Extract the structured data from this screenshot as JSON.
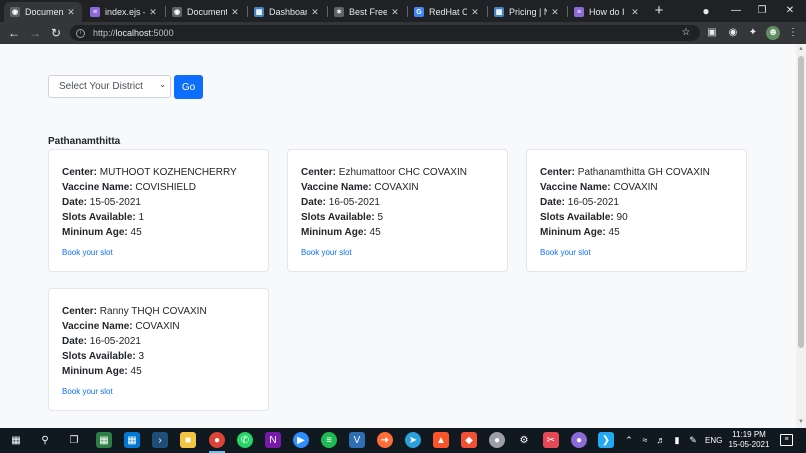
{
  "browser": {
    "tabs": [
      {
        "title": "Document",
        "favicon": "globe-icon",
        "color": "#35363a",
        "active": true
      },
      {
        "title": "index.ejs – ",
        "favicon": "vscode-icon",
        "color": "#8c6ad8"
      },
      {
        "title": "Document",
        "favicon": "globe-icon",
        "color": "#5f6368"
      },
      {
        "title": "Dashboard",
        "favicon": "dashboard-icon",
        "color": "#3d85c6"
      },
      {
        "title": "Best Free N",
        "favicon": "paw-icon",
        "color": "#5f6368"
      },
      {
        "title": "RedHat Op",
        "favicon": "google-icon",
        "color": "#4285f4"
      },
      {
        "title": "Pricing | Nc",
        "favicon": "dashboard-icon",
        "color": "#3d85c6"
      },
      {
        "title": "How do I s",
        "favicon": "chat-icon",
        "color": "#8c6ad8"
      }
    ],
    "url_scheme": "http://",
    "url_host": "localhost",
    "url_port": ":5000"
  },
  "page": {
    "select_placeholder": "Select Your District",
    "go_label": "Go",
    "district": "Pathanamthitta",
    "labels": {
      "center": "Center:",
      "vaccine": "Vaccine Name:",
      "date": "Date:",
      "slots": "Slots Available:",
      "age": "Mininum Age:"
    },
    "book_label": "Book your slot",
    "centers": [
      {
        "center": "MUTHOOT KOZHENCHERRY",
        "vaccine": "COVISHIELD",
        "date": "15-05-2021",
        "slots": "1",
        "age": "45"
      },
      {
        "center": "Ezhumattoor CHC COVAXIN",
        "vaccine": "COVAXIN",
        "date": "16-05-2021",
        "slots": "5",
        "age": "45"
      },
      {
        "center": "Pathanamthitta GH COVAXIN",
        "vaccine": "COVAXIN",
        "date": "16-05-2021",
        "slots": "90",
        "age": "45"
      },
      {
        "center": "Ranny THQH COVAXIN",
        "vaccine": "COVAXIN",
        "date": "16-05-2021",
        "slots": "3",
        "age": "45"
      }
    ]
  },
  "taskbar": {
    "lang": "ENG",
    "time": "11:19 PM",
    "date": "15-05-2021",
    "apps": [
      {
        "name": "windows-icon",
        "color": "#ffffff"
      },
      {
        "name": "search-icon",
        "color": "#ffffff"
      },
      {
        "name": "task-view-icon",
        "color": "#ffffff"
      },
      {
        "name": "calculator-icon",
        "color": "#2d7d46"
      },
      {
        "name": "store-icon",
        "color": "#0078d4"
      },
      {
        "name": "terminal-icon",
        "color": "#1f4e79"
      },
      {
        "name": "file-explorer-icon",
        "color": "#f4c542"
      },
      {
        "name": "chrome-icon",
        "color": "#db4437"
      },
      {
        "name": "whatsapp-icon",
        "color": "#25d366"
      },
      {
        "name": "onenote-icon",
        "color": "#7719aa"
      },
      {
        "name": "zoom-icon",
        "color": "#2d8cff"
      },
      {
        "name": "spotify-icon",
        "color": "#1db954"
      },
      {
        "name": "vbox-icon",
        "color": "#2f6db5"
      },
      {
        "name": "postman-icon",
        "color": "#ff6c37"
      },
      {
        "name": "telegram-icon",
        "color": "#2aa1da"
      },
      {
        "name": "brave-icon",
        "color": "#fb542b"
      },
      {
        "name": "git-icon",
        "color": "#f05033"
      },
      {
        "name": "disk-icon",
        "color": "#9aa0a6"
      },
      {
        "name": "settings-icon",
        "color": "#ffffff"
      },
      {
        "name": "snip-icon",
        "color": "#e74856"
      },
      {
        "name": "github-icon",
        "color": "#8c6ad8"
      },
      {
        "name": "vscode-icon",
        "color": "#23a9f2"
      }
    ]
  }
}
